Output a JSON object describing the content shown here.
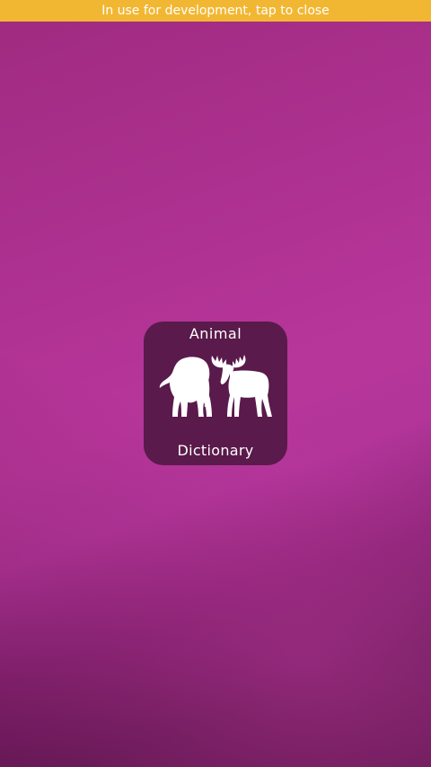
{
  "banner": {
    "text": "In use for development, tap to close",
    "color": "#f2b732"
  },
  "logo": {
    "title_top": "Animal",
    "title_bottom": "Dictionary",
    "icons": [
      "elephant-icon",
      "moose-icon"
    ],
    "tile_color": "#5a1a4b"
  },
  "background": {
    "colors": [
      "#9f2a7f",
      "#b7369a",
      "#6d1f5e"
    ]
  }
}
